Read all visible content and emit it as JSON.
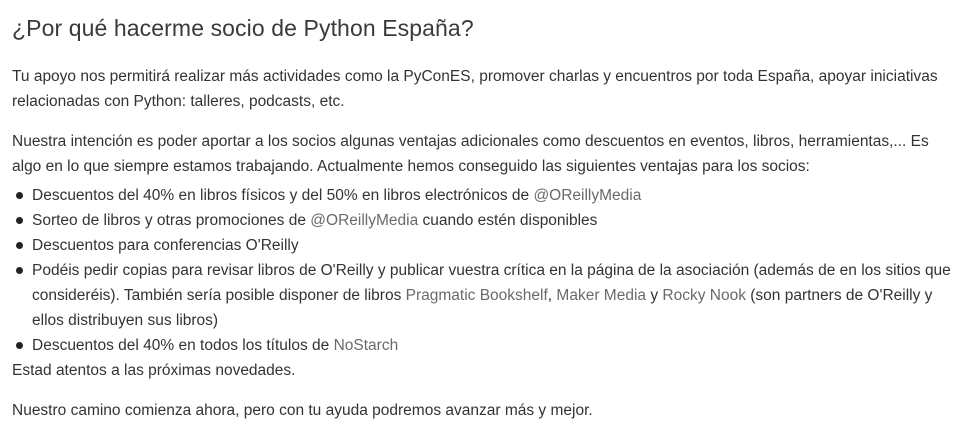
{
  "section": {
    "heading": "¿Por qué hacerme socio de Python España?",
    "paragraph1": "Tu apoyo nos permitirá realizar más actividades como la PyConES, promover charlas y encuentros por toda España, apoyar iniciativas relacionadas con Python: talleres, podcasts, etc.",
    "paragraph2": "Nuestra intención es poder aportar a los socios algunas ventajas adicionales como descuentos en eventos, libros, herramientas,... Es algo en lo que siempre estamos trabajando. Actualmente hemos conseguido las siguientes ventajas para los socios:",
    "benefits": [
      {
        "pre": "Descuentos del 40% en libros físicos y del 50% en libros electrónicos de ",
        "link": "@OReillyMedia"
      },
      {
        "pre": "Sorteo de libros y otras promociones de ",
        "link": "@OReillyMedia",
        "post": " cuando estén disponibles"
      },
      {
        "text": "Descuentos para conferencias O'Reilly"
      },
      {
        "pre": "Podéis pedir copias para revisar libros de O'Reilly y publicar vuestra crítica en la página de la asociación (además de en los sitios que consideréis). También sería posible disponer de libros ",
        "link1": "Pragmatic Bookshelf",
        "sep1": ", ",
        "link2": "Maker Media",
        "sep2": " y ",
        "link3": "Rocky Nook",
        "post": " (son partners de O'Reilly y ellos distribuyen sus libros)"
      },
      {
        "pre": "Descuentos del 40% en todos los títulos de ",
        "link": "NoStarch"
      }
    ],
    "note": "Estad atentos a las próximas novedades.",
    "closing": "Nuestro camino comienza ahora, pero con tu ayuda podremos avanzar más y mejor."
  }
}
